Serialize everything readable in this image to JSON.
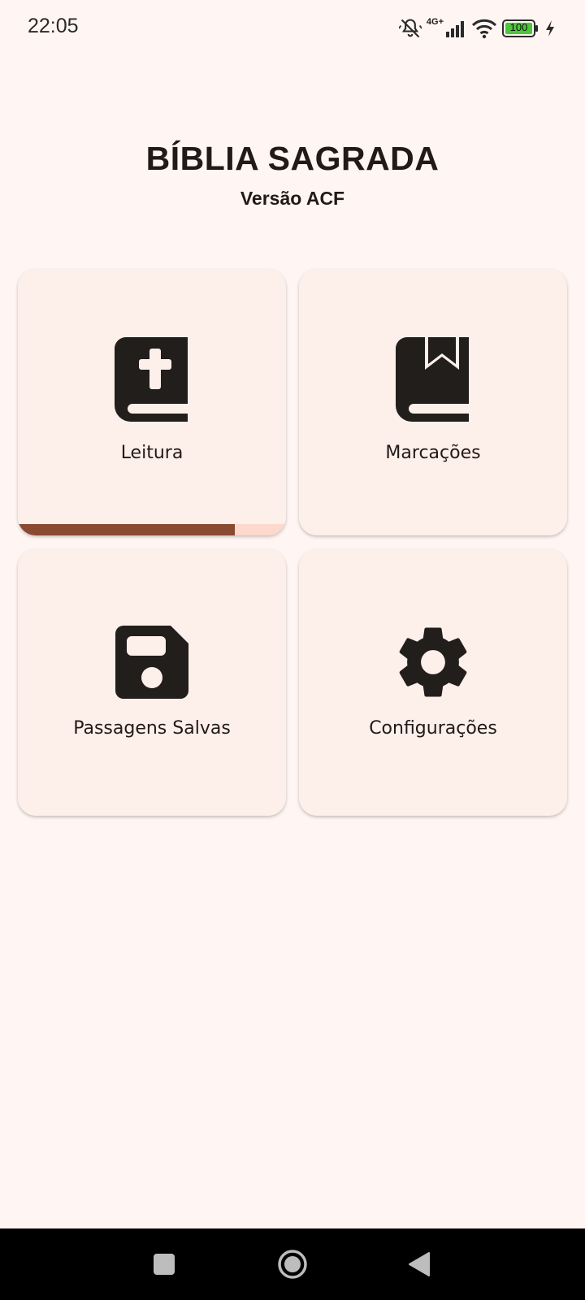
{
  "status_bar": {
    "time": "22:05",
    "network_label": "4G+",
    "battery_level": "100",
    "icons": [
      "muted-bell-icon",
      "signal-icon",
      "wifi-icon",
      "battery-icon",
      "charging-bolt-icon"
    ]
  },
  "header": {
    "title": "BÍBLIA SAGRADA",
    "subtitle": "Versão ACF"
  },
  "menu": [
    {
      "label": "Leitura",
      "icon": "bible-icon",
      "progress_fraction": 0.81
    },
    {
      "label": "Marcações",
      "icon": "bookmarked-book-icon"
    },
    {
      "label": "Passagens Salvas",
      "icon": "floppy-disk-icon"
    },
    {
      "label": "Configurações",
      "icon": "gear-icon"
    }
  ],
  "colors": {
    "background": "#fff6f3",
    "card": "#fdefea",
    "progress_fill": "#8a4a32",
    "progress_track": "#fdd8cd",
    "text": "#221a18"
  },
  "nav_bar": {
    "buttons": [
      "recents-button",
      "home-button",
      "back-button"
    ]
  }
}
